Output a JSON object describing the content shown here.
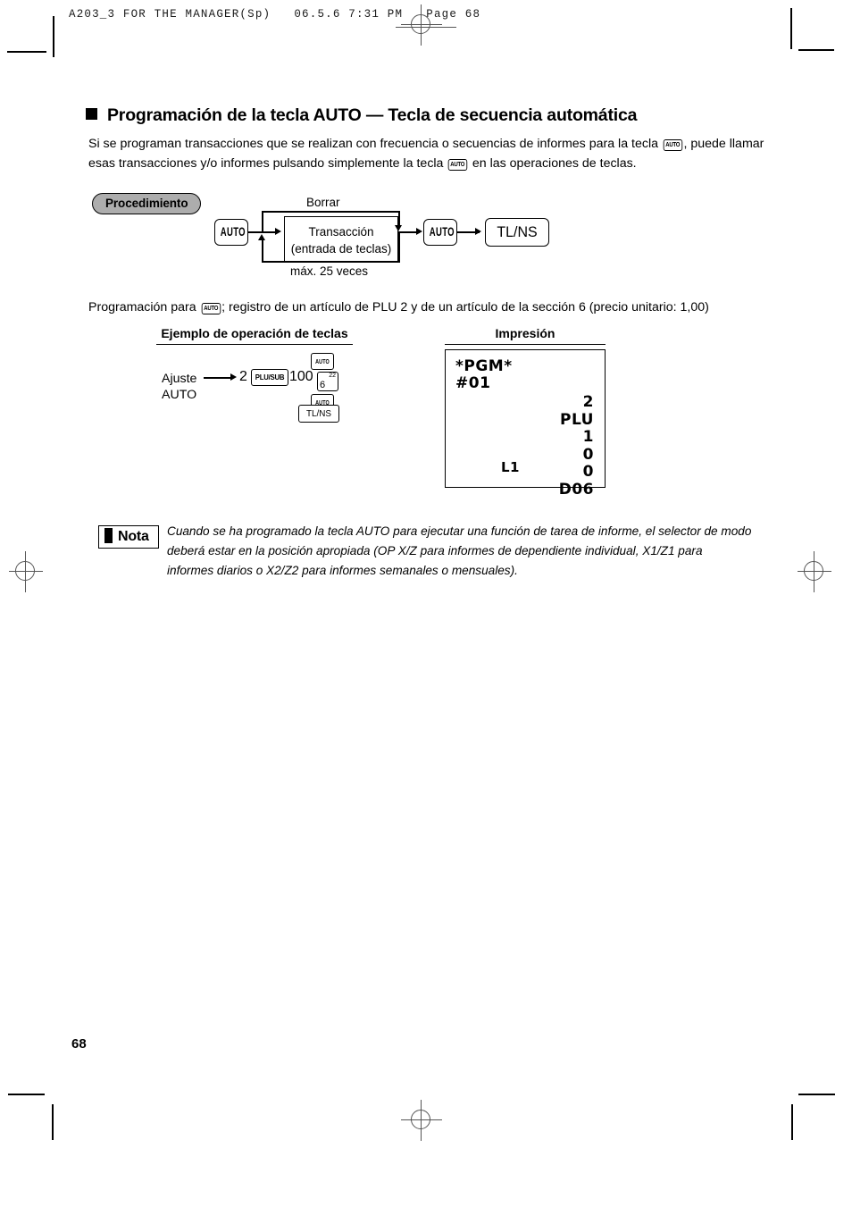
{
  "scan_header": {
    "text": "A203_3 FOR THE MANAGER(Sp)   06.5.6 7:31 PM   Page 68"
  },
  "section": {
    "title": "Programación de la tecla AUTO — Tecla de secuencia automática",
    "intro_part1": "Si se programan transacciones que se realizan con frecuencia o secuencias de informes para la tecla ",
    "intro_key1": "AUTO",
    "intro_part2": ", puede llamar esas transacciones y/o informes pulsando simplemente la tecla ",
    "intro_key2": "AUTO",
    "intro_part3": " en las operaciones de teclas."
  },
  "procedure": {
    "badge": "Procedimiento",
    "label_clear": "Borrar",
    "label_max": "máx. 25 veces",
    "key_auto_start": "AUTO",
    "box_line1": "Transacción",
    "box_line2": "(entrada de teclas)",
    "key_auto_end": "AUTO",
    "key_tlns": "TL/NS"
  },
  "program_note": {
    "part1": "Programación para ",
    "key": "AUTO",
    "part2": "; registro de un artículo de PLU 2 y de un artículo de la sección 6 (precio unitario: 1,00)"
  },
  "example": {
    "heading": "Ejemplo de operación de teclas",
    "label_line1": "Ajuste",
    "label_line2": "AUTO",
    "entry_plu_number": "2",
    "key_plusub": "PLU/SUB",
    "entry_price": "100",
    "key_dept_number": "6",
    "key_dept_super": "22",
    "key_auto_top": "AUTO",
    "key_auto_bottom": "AUTO",
    "key_tlns": "TL/NS"
  },
  "print": {
    "heading": "Impresión",
    "receipt": {
      "line_pgm": "*PGM*",
      "line_number": "#01",
      "right_lines": [
        "2",
        "PLU",
        "1",
        "0",
        "0",
        "D06"
      ],
      "left_bottom": "L1"
    }
  },
  "note": {
    "label": "Nota",
    "text": "Cuando se ha programado la tecla AUTO para ejecutar una función de tarea de informe, el selector de modo deberá estar en la posición apropiada (OP X/Z para informes de dependiente individual, X1/Z1 para informes diarios o X2/Z2 para informes semanales o mensuales)."
  },
  "footer": {
    "page_number": "68"
  }
}
